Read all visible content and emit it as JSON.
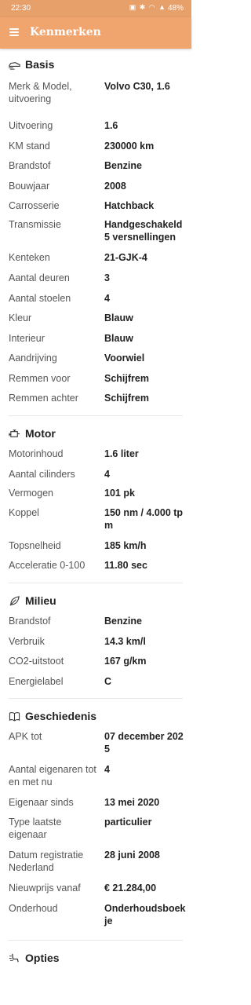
{
  "status_bar": {
    "time": "22:30",
    "icons": "▣ ✱ ◠ ▲",
    "battery": "48%"
  },
  "app_bar": {
    "title": "Kenmerken",
    "menu_icon": "hamburger-menu-icon"
  },
  "sections": {
    "basis": {
      "title": "Basis",
      "icon": "car-icon",
      "rows": [
        {
          "label": "Merk & Model, uitvoering",
          "value": "Volvo C30, 1.6"
        },
        {
          "label": "Uitvoering",
          "value": "1.6"
        },
        {
          "label": "KM stand",
          "value": "230000 km"
        },
        {
          "label": "Brandstof",
          "value": "Benzine"
        },
        {
          "label": "Bouwjaar",
          "value": "2008"
        },
        {
          "label": "Carrosserie",
          "value": "Hatchback"
        },
        {
          "label": "Transmissie",
          "value": "Handgeschakeld 5 versnellingen"
        },
        {
          "label": "Kenteken",
          "value": "21-GJK-4"
        },
        {
          "label": "Aantal deuren",
          "value": "3"
        },
        {
          "label": "Aantal stoelen",
          "value": "4"
        },
        {
          "label": "Kleur",
          "value": "Blauw"
        },
        {
          "label": "Interieur",
          "value": "Blauw"
        },
        {
          "label": "Aandrijving",
          "value": "Voorwiel"
        },
        {
          "label": "Remmen voor",
          "value": "Schijfrem"
        },
        {
          "label": "Remmen achter",
          "value": "Schijfrem"
        }
      ]
    },
    "motor": {
      "title": "Motor",
      "icon": "engine-icon",
      "rows": [
        {
          "label": "Motorinhoud",
          "value": "1.6 liter"
        },
        {
          "label": "Aantal cilinders",
          "value": "4"
        },
        {
          "label": "Vermogen",
          "value": "101 pk"
        },
        {
          "label": "Koppel",
          "value": "150 nm / 4.000 tpm"
        },
        {
          "label": "Topsnelheid",
          "value": "185 km/h"
        },
        {
          "label": "Acceleratie 0-100",
          "value": "11.80 sec"
        }
      ]
    },
    "milieu": {
      "title": "Milieu",
      "icon": "leaf-icon",
      "rows": [
        {
          "label": "Brandstof",
          "value": "Benzine"
        },
        {
          "label": "Verbruik",
          "value": "14.3 km/l"
        },
        {
          "label": "CO2-uitstoot",
          "value": "167 g/km"
        },
        {
          "label": "Energielabel",
          "value": "C"
        }
      ]
    },
    "geschiedenis": {
      "title": "Geschiedenis",
      "icon": "book-icon",
      "rows": [
        {
          "label": "APK tot",
          "value": "07 december 2025"
        },
        {
          "label": "Aantal eigenaren tot en met nu",
          "value": "4"
        },
        {
          "label": "Eigenaar sinds",
          "value": "13 mei 2020"
        },
        {
          "label": "Type laatste eigenaar",
          "value": "particulier"
        },
        {
          "label": "Datum registratie Nederland",
          "value": "28 juni 2008"
        },
        {
          "label": "Nieuwprijs vanaf",
          "value": "€ 21.284,00"
        },
        {
          "label": "Onderhoud",
          "value": "Onderhoudsboekje"
        }
      ]
    },
    "opties": {
      "title": "Opties",
      "icon": "seat-icon"
    }
  }
}
